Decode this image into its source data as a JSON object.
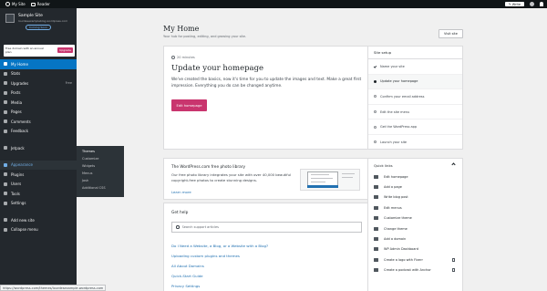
{
  "topbar": {
    "my_sites": "My Site",
    "reader": "Reader",
    "write": "Write"
  },
  "sidebar": {
    "site_name": "Sample Site",
    "site_url": "lourdesexampleblog.wordpress.com",
    "coming_soon": "Coming Soon",
    "upgrade_text": "Free domain with an annual plan",
    "upgrade_button": "Upgrade",
    "items": [
      {
        "label": "My Home",
        "icon": "home-icon"
      },
      {
        "label": "Stats",
        "icon": "stats-icon"
      },
      {
        "label": "Upgrades",
        "icon": "upgrades-icon",
        "badge": "Free"
      },
      {
        "label": "Posts",
        "icon": "posts-icon"
      },
      {
        "label": "Media",
        "icon": "media-icon"
      },
      {
        "label": "Pages",
        "icon": "pages-icon"
      },
      {
        "label": "Comments",
        "icon": "comments-icon"
      },
      {
        "label": "Feedback",
        "icon": "feedback-icon"
      },
      {
        "label": "Jetpack",
        "icon": "jetpack-icon"
      },
      {
        "label": "Appearance",
        "icon": "appearance-icon"
      },
      {
        "label": "Plugins",
        "icon": "plugins-icon"
      },
      {
        "label": "Users",
        "icon": "users-icon"
      },
      {
        "label": "Tools",
        "icon": "tools-icon"
      },
      {
        "label": "Settings",
        "icon": "settings-icon"
      },
      {
        "label": "Add new site",
        "icon": "add-site-icon"
      },
      {
        "label": "Collapse menu",
        "icon": "collapse-icon"
      }
    ],
    "submenu": [
      "Themes",
      "Customize",
      "Widgets",
      "Menus",
      "Josh",
      "Additional CSS"
    ]
  },
  "status_url": "https://wordpress.com/themes/lourdesexample.wordpress.com",
  "main": {
    "title": "My Home",
    "subtitle": "Your hub for posting, editing, and growing your site.",
    "visit_site": "Visit site",
    "task": {
      "time": "20 minutes",
      "title": "Update your homepage",
      "description": "We've created the basics, now it's time for you to update the images and text. Make a great first impression. Everything you do can be changed anytime.",
      "button": "Edit homepage"
    },
    "setup": {
      "title": "Site setup",
      "items": [
        {
          "label": "Name your site",
          "state": "done"
        },
        {
          "label": "Update your homepage",
          "state": "current"
        },
        {
          "label": "Confirm your email address",
          "state": "todo"
        },
        {
          "label": "Edit the site menu",
          "state": "todo"
        },
        {
          "label": "Get the WordPress app",
          "state": "todo"
        },
        {
          "label": "Launch your site",
          "state": "todo"
        }
      ]
    },
    "photo": {
      "title": "The WordPress.com free photo library",
      "description": "Our free photo library integrates your site with over 40,000 beautiful copyright-free photos to create stunning designs.",
      "learn_more": "Learn more"
    },
    "help": {
      "title": "Get help",
      "search_placeholder": "Search support articles",
      "links": [
        "Do I Need a Website, a Blog, or a Website with a Blog?",
        "Uploading custom plugins and themes",
        "All About Domains",
        "Quick-Start Guide",
        "Privacy Settings"
      ]
    },
    "quick_links": {
      "title": "Quick links",
      "items": [
        {
          "label": "Edit homepage",
          "icon": "edit-page-icon",
          "external": false
        },
        {
          "label": "Add a page",
          "icon": "add-page-icon",
          "external": false
        },
        {
          "label": "Write blog post",
          "icon": "write-icon",
          "external": false
        },
        {
          "label": "Edit menus",
          "icon": "menus-icon",
          "external": false
        },
        {
          "label": "Customize theme",
          "icon": "customize-icon",
          "external": false
        },
        {
          "label": "Change theme",
          "icon": "theme-icon",
          "external": false
        },
        {
          "label": "Add a domain",
          "icon": "domain-icon",
          "external": false
        },
        {
          "label": "WP Admin Dashboard",
          "icon": "wp-admin-icon",
          "external": false
        },
        {
          "label": "Create a logo with Fiverr",
          "icon": "logo-icon",
          "external": true
        },
        {
          "label": "Create a podcast with Anchor",
          "icon": "podcast-icon",
          "external": true
        }
      ]
    }
  },
  "colors": {
    "accent": "#c9356e",
    "sidebar_bg": "#23282d",
    "active_item": "#0675c4",
    "link": "#2271b1"
  }
}
